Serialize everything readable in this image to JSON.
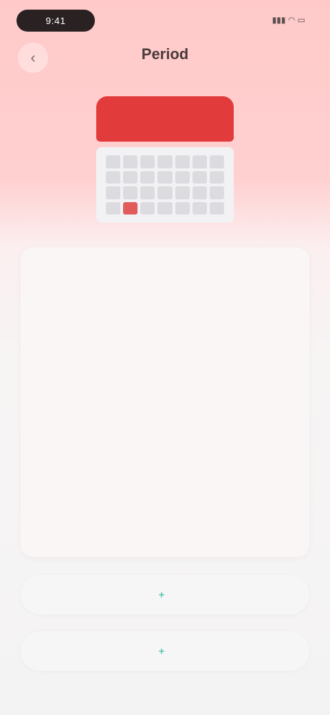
{
  "status": {
    "time": "9:41",
    "icons": "▮▮▮ ◠ ▭"
  },
  "header": {
    "title": "Period"
  },
  "calendar": {
    "month": ""
  },
  "card": {
    "heading": "",
    "subtitle": "",
    "note": ""
  },
  "buttons": [
    {
      "icon": "plus-icon",
      "label": ""
    },
    {
      "icon": "plus-icon",
      "label": ""
    }
  ],
  "colors": {
    "accent": "#e23b3b",
    "teal": "#62c8b4"
  }
}
